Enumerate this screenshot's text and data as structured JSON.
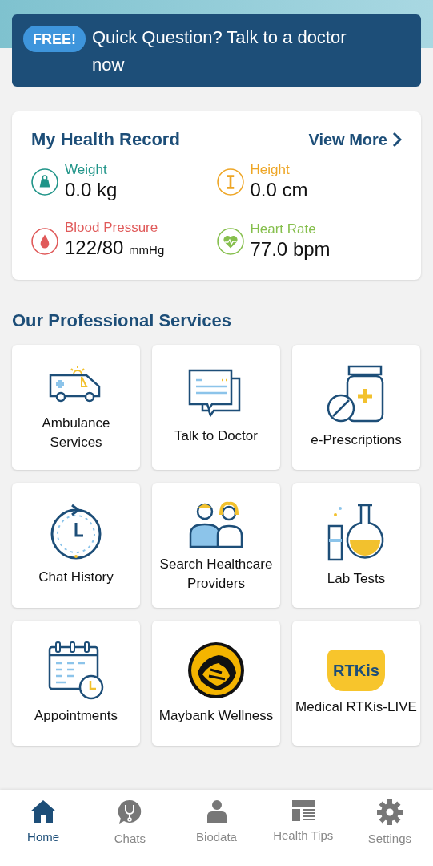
{
  "banner": {
    "badge": "FREE!",
    "text": "Quick Question? Talk to a doctor now"
  },
  "health_record": {
    "title": "My Health Record",
    "link": "View More",
    "metrics": [
      {
        "kind": "weight",
        "label": "Weight",
        "value": "0.0 kg",
        "color": "#1f9488"
      },
      {
        "kind": "height",
        "label": "Height",
        "value": "0.0 cm",
        "color": "#eea626"
      },
      {
        "kind": "blood",
        "label": "Blood Pressure",
        "value": "122/80",
        "unit": "mmHg",
        "color": "#e05a5a"
      },
      {
        "kind": "heart",
        "label": "Heart Rate",
        "value": "77.0 bpm",
        "color": "#86bf4d"
      }
    ]
  },
  "services_title": "Our Professional Services",
  "services": [
    {
      "kind": "ambulance",
      "label": "Ambulance Services"
    },
    {
      "kind": "chat",
      "label": "Talk to Doctor"
    },
    {
      "kind": "pills",
      "label": "e-Prescriptions"
    },
    {
      "kind": "history",
      "label": "Chat History"
    },
    {
      "kind": "doctors",
      "label": "Search Healthcare Providers"
    },
    {
      "kind": "lab",
      "label": "Lab Tests"
    },
    {
      "kind": "calendar",
      "label": "Appointments"
    },
    {
      "kind": "tiger",
      "label": "Maybank Wellness"
    },
    {
      "kind": "rtkis",
      "label": "Medical RTKis-LIVE",
      "logo_text": "RTKis"
    }
  ],
  "nav": [
    {
      "kind": "home",
      "label": "Home",
      "selected": true
    },
    {
      "kind": "chats",
      "label": "Chats",
      "selected": false
    },
    {
      "kind": "person",
      "label": "Biodata",
      "selected": false
    },
    {
      "kind": "tips",
      "label": "Health Tips",
      "selected": false
    },
    {
      "kind": "gear",
      "label": "Settings",
      "selected": false
    }
  ]
}
